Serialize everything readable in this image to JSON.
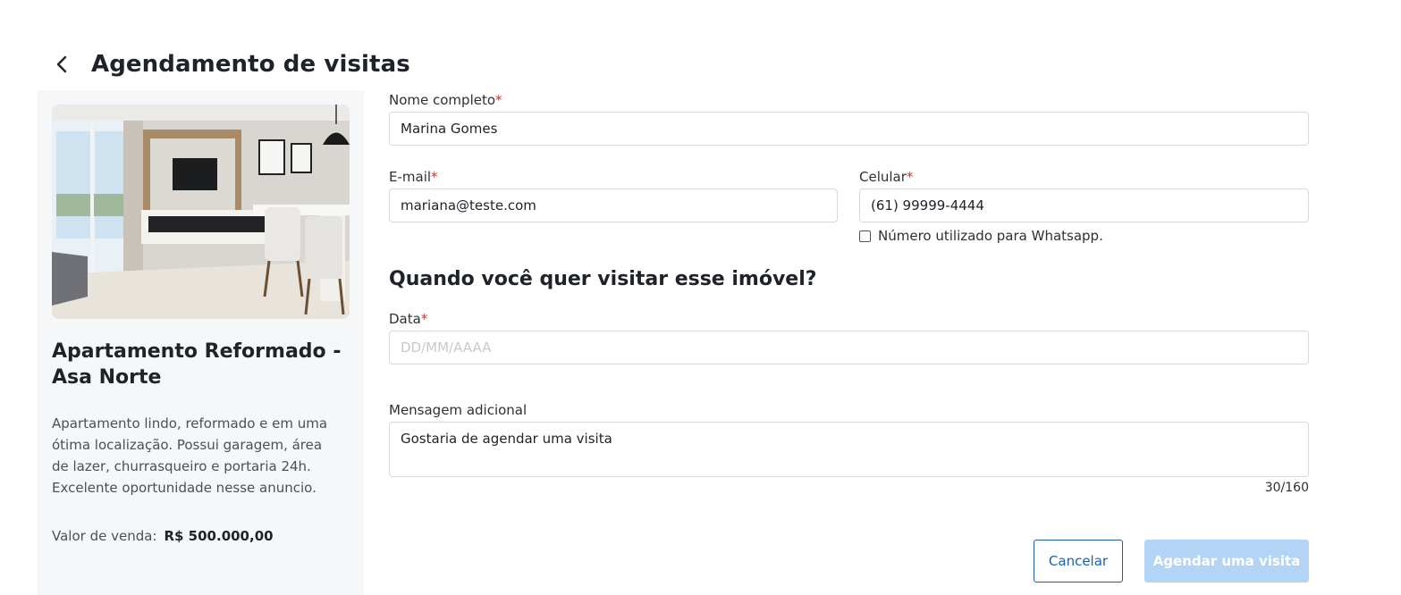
{
  "header": {
    "title": "Agendamento de visitas",
    "back_icon": "chevron-left-icon"
  },
  "property": {
    "title": "Apartamento Reformado - Asa Norte",
    "description": "Apartamento lindo, reformado e em uma ótima localização. Possui garagem, área de lazer, churrasqueiro e portaria 24h. Excelente oportunidade nesse anuncio.",
    "price_label": "Valor de venda:",
    "price_value": "R$ 500.000,00"
  },
  "form": {
    "name": {
      "label": "Nome completo",
      "required": "*",
      "value": "Marina Gomes"
    },
    "email": {
      "label": "E-mail",
      "required": "*",
      "value": "mariana@teste.com"
    },
    "phone": {
      "label": "Celular",
      "required": "*",
      "value": "(61) 99999-4444"
    },
    "whatsapp": {
      "label": "Número utilizado para Whatsapp.",
      "checked": false
    },
    "section_title": "Quando você quer visitar esse imóvel?",
    "date": {
      "label": "Data",
      "required": "*",
      "placeholder": "DD/MM/AAAA",
      "value": ""
    },
    "message": {
      "label": "Mensagem adicional",
      "value": "Gostaria de agendar uma visita",
      "counter": "30/160"
    }
  },
  "actions": {
    "cancel_label": "Cancelar",
    "submit_label": "Agendar uma visita"
  },
  "colors": {
    "primary": "#1a5fb4",
    "primary_disabled": "#b3d4f5",
    "required": "#d93025",
    "card_bg": "#f6f7f8"
  }
}
